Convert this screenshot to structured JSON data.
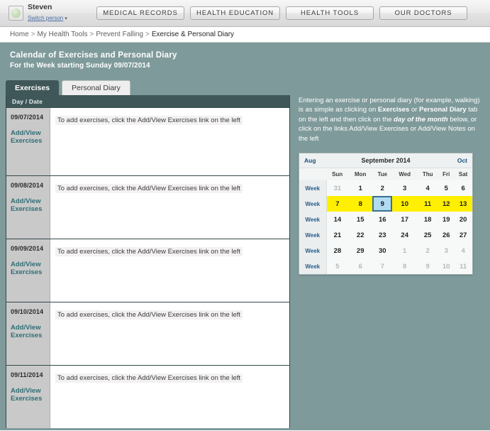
{
  "topbar": {
    "user_name": "Steven",
    "switch_person_label": "Switch person",
    "caret": "▾",
    "nav_buttons": [
      {
        "label": "MEDICAL RECORDS"
      },
      {
        "label": "HEALTH EDUCATION"
      },
      {
        "label": "HEALTH TOOLS"
      },
      {
        "label": "OUR DOCTORS"
      }
    ]
  },
  "breadcrumb": {
    "items": [
      "Home",
      "My Health Tools",
      "Prevent Falling",
      "Exercise & Personal Diary"
    ],
    "separator": ">"
  },
  "page": {
    "title": "Calendar of Exercises and Personal Diary",
    "subtitle": "For the Week starting Sunday 09/07/2014"
  },
  "tabs": [
    {
      "label": "Exercises",
      "active": true
    },
    {
      "label": "Personal Diary",
      "active": false
    }
  ],
  "table": {
    "header": "Day / Date",
    "rows": [
      {
        "date": "09/07/2014",
        "link": "Add/View Exercises",
        "hint": "To add exercises, click the Add/View Exercises link on the left"
      },
      {
        "date": "09/08/2014",
        "link": "Add/View Exercises",
        "hint": "To add exercises, click the Add/View Exercises link on the left"
      },
      {
        "date": "09/09/2014",
        "link": "Add/View Exercises",
        "hint": "To add exercises, click the Add/View Exercises link on the left"
      },
      {
        "date": "09/10/2014",
        "link": "Add/View Exercises",
        "hint": "To add exercises, click the Add/View Exercises link on the left"
      },
      {
        "date": "09/11/2014",
        "link": "Add/View Exercises",
        "hint": "To add exercises, click the Add/View Exercises link on the left"
      }
    ]
  },
  "instructions": {
    "p1": "Entering an exercise or personal diary (for example, walking) is as simple as clicking on ",
    "b1": "Exercises",
    "p2": " or ",
    "b2": "Personal Diary",
    "p3": " tab on the left and then click on the ",
    "b3": "day of the month",
    "p4": " below, or click on the links Add/View Exercises or Add/View Notes on the left"
  },
  "calendar": {
    "prev_label": "Aug",
    "title": "September 2014",
    "next_label": "Oct",
    "week_label": "Week",
    "weekday_headers": [
      "Sun",
      "Mon",
      "Tue",
      "Wed",
      "Thu",
      "Fri",
      "Sat"
    ],
    "selected_day": 9,
    "highlighted_week_index": 1,
    "weeks": [
      {
        "days": [
          {
            "n": "31",
            "other": true
          },
          {
            "n": "1"
          },
          {
            "n": "2"
          },
          {
            "n": "3"
          },
          {
            "n": "4"
          },
          {
            "n": "5"
          },
          {
            "n": "6"
          }
        ]
      },
      {
        "days": [
          {
            "n": "7"
          },
          {
            "n": "8"
          },
          {
            "n": "9",
            "selected": true
          },
          {
            "n": "10"
          },
          {
            "n": "11"
          },
          {
            "n": "12"
          },
          {
            "n": "13"
          }
        ]
      },
      {
        "days": [
          {
            "n": "14"
          },
          {
            "n": "15"
          },
          {
            "n": "16"
          },
          {
            "n": "17"
          },
          {
            "n": "18"
          },
          {
            "n": "19"
          },
          {
            "n": "20"
          }
        ]
      },
      {
        "days": [
          {
            "n": "21"
          },
          {
            "n": "22"
          },
          {
            "n": "23"
          },
          {
            "n": "24"
          },
          {
            "n": "25"
          },
          {
            "n": "26"
          },
          {
            "n": "27"
          }
        ]
      },
      {
        "days": [
          {
            "n": "28"
          },
          {
            "n": "29"
          },
          {
            "n": "30"
          },
          {
            "n": "1",
            "other": true
          },
          {
            "n": "2",
            "other": true
          },
          {
            "n": "3",
            "other": true
          },
          {
            "n": "4",
            "other": true
          }
        ]
      },
      {
        "days": [
          {
            "n": "5",
            "other": true
          },
          {
            "n": "6",
            "other": true
          },
          {
            "n": "7",
            "other": true
          },
          {
            "n": "8",
            "other": true
          },
          {
            "n": "9",
            "other": true
          },
          {
            "n": "10",
            "other": true
          },
          {
            "n": "11",
            "other": true
          }
        ]
      }
    ]
  },
  "colors": {
    "teal_background": "#7f9a9b",
    "dark_teal": "#3f5759",
    "highlight_yellow": "#ffef00",
    "selected_blue": "#b0dbf0",
    "link_teal": "#2f6e76",
    "gray_cell": "#c9c9c9"
  }
}
